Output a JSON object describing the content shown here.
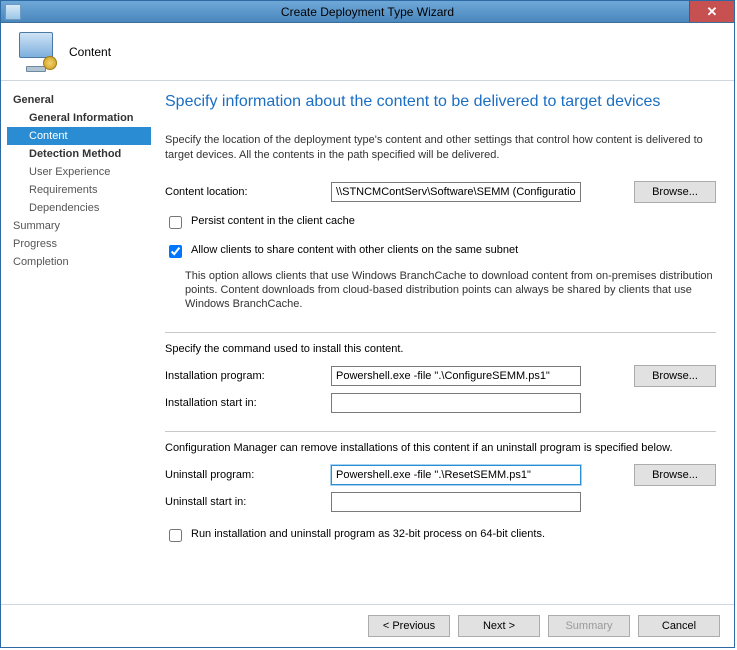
{
  "window": {
    "title": "Create Deployment Type Wizard",
    "close_glyph": "✕"
  },
  "header": {
    "step_name": "Content"
  },
  "sidebar": {
    "items": [
      {
        "label": "General",
        "level": 0,
        "bold": true
      },
      {
        "label": "General Information",
        "level": 1,
        "bold": true
      },
      {
        "label": "Content",
        "level": 1,
        "bold": false,
        "active": true
      },
      {
        "label": "Detection Method",
        "level": 1,
        "bold": true
      },
      {
        "label": "User Experience",
        "level": 1,
        "bold": false
      },
      {
        "label": "Requirements",
        "level": 1,
        "bold": false
      },
      {
        "label": "Dependencies",
        "level": 1,
        "bold": false
      },
      {
        "label": "Summary",
        "level": 0,
        "bold": false
      },
      {
        "label": "Progress",
        "level": 0,
        "bold": false
      },
      {
        "label": "Completion",
        "level": 0,
        "bold": false
      }
    ]
  },
  "main": {
    "heading": "Specify information about the content to be delivered to target devices",
    "intro": "Specify the location of the deployment type's content and other settings that control how content is delivered to target devices. All the contents in the path specified will be delivered.",
    "content_location_label": "Content location:",
    "content_location_value": "\\\\STNCMContServ\\Software\\SEMM (Configuratio",
    "browse_label": "Browse...",
    "persist_label": "Persist content in the client cache",
    "persist_checked": false,
    "allow_share_label": "Allow clients to share content with other clients on the same subnet",
    "allow_share_checked": true,
    "branchcache_note": "This option allows clients that use Windows BranchCache to download content from on-premises distribution points. Content downloads from cloud-based distribution points can always be shared by clients that use Windows BranchCache.",
    "install_section_intro": "Specify the command used to install this content.",
    "install_program_label": "Installation program:",
    "install_program_value": "Powershell.exe -file \".\\ConfigureSEMM.ps1\"",
    "install_start_label": "Installation start in:",
    "install_start_value": "",
    "uninstall_section_intro": "Configuration Manager can remove installations of this content if an uninstall program is specified below.",
    "uninstall_program_label": "Uninstall program:",
    "uninstall_program_value": "Powershell.exe -file \".\\ResetSEMM.ps1\"",
    "uninstall_start_label": "Uninstall start in:",
    "uninstall_start_value": "",
    "run32_label": "Run installation and uninstall program as 32-bit process on 64-bit clients.",
    "run32_checked": false
  },
  "buttons": {
    "previous": "< Previous",
    "next": "Next >",
    "summary": "Summary",
    "cancel": "Cancel"
  }
}
